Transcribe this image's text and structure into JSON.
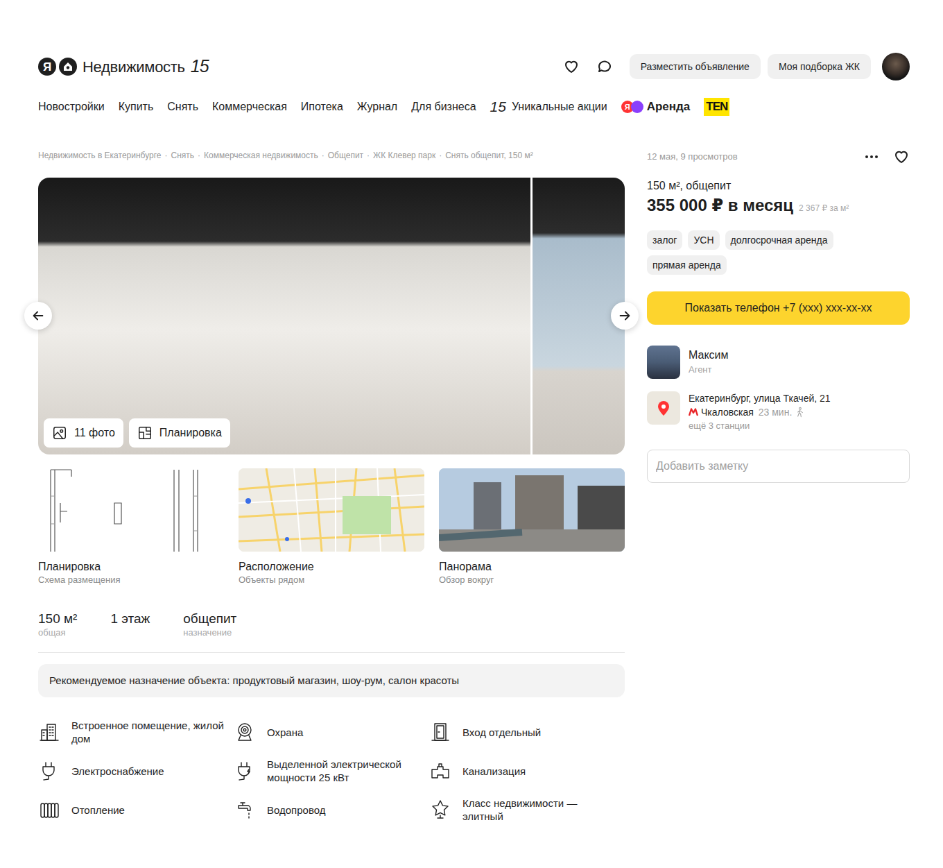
{
  "header": {
    "logo": {
      "letter": "Я",
      "name": "Недвижимость",
      "badge": "15"
    },
    "actions": [
      "Разместить объявление",
      "Моя подборка ЖК"
    ]
  },
  "nav": [
    {
      "label": "Новостройки",
      "kind": "link"
    },
    {
      "label": "Купить",
      "kind": "link"
    },
    {
      "label": "Снять",
      "kind": "link"
    },
    {
      "label": "Коммерческая",
      "kind": "link"
    },
    {
      "label": "Ипотека",
      "kind": "link"
    },
    {
      "label": "Журнал",
      "kind": "link"
    },
    {
      "label": "Для бизнеса",
      "kind": "link"
    },
    {
      "label": "Уникальные акции",
      "prefix": "15",
      "kind": "promo"
    },
    {
      "label": "Аренда",
      "prefix": "Я",
      "kind": "brand"
    },
    {
      "label": "TEN",
      "kind": "logo"
    }
  ],
  "breadcrumbs": {
    "separator": "·",
    "items": [
      "Недвижимость в Екатеринбурге",
      "Снять",
      "Коммерческая недвижимость",
      "Общепит",
      "ЖК Клевер парк",
      "Снять общепит, 150 м²"
    ]
  },
  "gallery": {
    "buttons": [
      "11 фото",
      "Планировка"
    ]
  },
  "thumbnails": [
    {
      "title": "Планировка",
      "subtitle": "Схема размещения",
      "kind": "plan"
    },
    {
      "title": "Расположение",
      "subtitle": "Объекты рядом",
      "kind": "map"
    },
    {
      "title": "Панорама",
      "subtitle": "Обзор вокруг",
      "kind": "photo"
    }
  ],
  "stats": [
    {
      "value": "150 м²",
      "caption": "общая"
    },
    {
      "value": "1 этаж"
    },
    {
      "value": "общепит",
      "caption": "назначение"
    }
  ],
  "recommendation": "Рекомендуемое назначение объекта: продуктовый магазин, шоу-рум, салон красоты",
  "features": [
    "Встроенное помещение, жилой дом",
    "Охрана",
    "Вход отдельный",
    "Электроснабжение",
    "Выделенной электрической мощности 25 кВт",
    "Канализация",
    "Отопление",
    "Водопровод",
    "Класс недвижимости — элитный"
  ],
  "offer": {
    "meta": "12 мая, 9 просмотров",
    "title": "150 м², общепит",
    "price": "355 000 ₽ в месяц",
    "price_per_m2": "2 367 ₽ за м²",
    "tags": [
      "залог",
      "УСН",
      "долгосрочная аренда",
      "прямая аренда"
    ],
    "phone_button": "Показать телефон +7 (xxx) xxx-xx-xx"
  },
  "agent": {
    "name": "Максим",
    "role": "Агент"
  },
  "location": {
    "address": "Екатеринбург, улица Ткачей, 21",
    "station": "Чкаловская",
    "time": "23 мин.",
    "more": "ещё 3 станции"
  },
  "note": {
    "placeholder": "Добавить заметку"
  }
}
